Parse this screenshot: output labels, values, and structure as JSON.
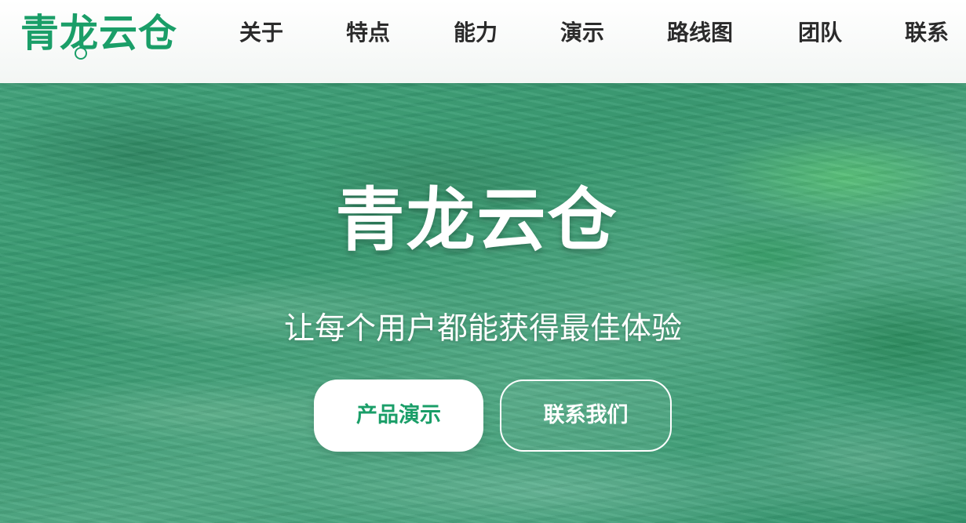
{
  "brand": {
    "name": "青龙云仓",
    "color": "#1a9e68"
  },
  "nav": {
    "items": [
      {
        "label": "关于"
      },
      {
        "label": "特点"
      },
      {
        "label": "能力"
      },
      {
        "label": "演示"
      },
      {
        "label": "路线图"
      },
      {
        "label": "团队"
      },
      {
        "label": "联系"
      }
    ]
  },
  "hero": {
    "title": "青龙云仓",
    "subtitle": "让每个用户都能获得最佳体验",
    "background": "aerial-mountain-landscape-image",
    "primary_button": "产品演示",
    "secondary_button": "联系我们"
  }
}
